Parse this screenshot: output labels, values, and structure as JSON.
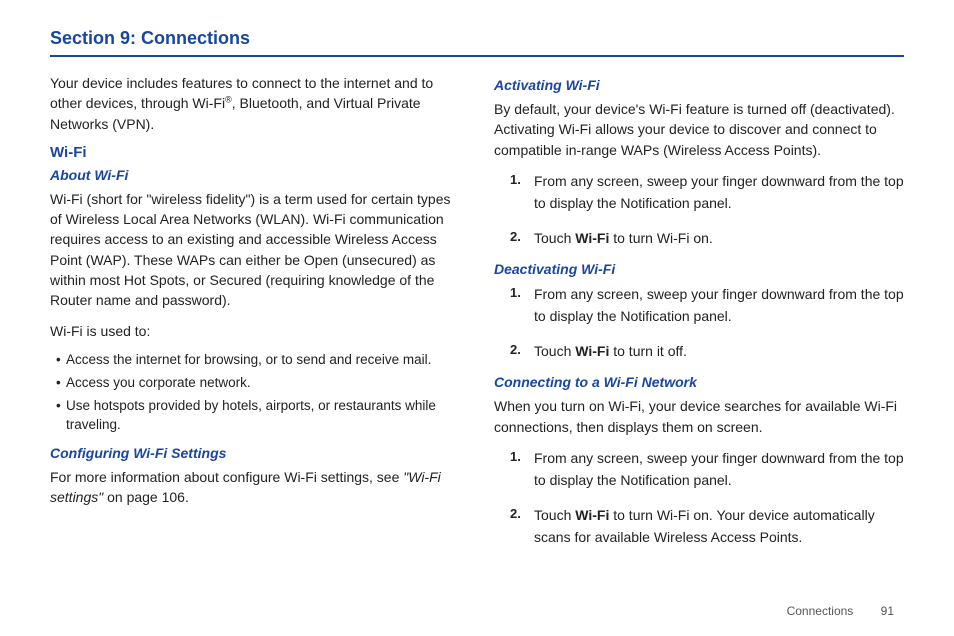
{
  "section_title": "Section 9: Connections",
  "left": {
    "intro_a": "Your device includes features to connect to the internet and to other devices, through Wi-Fi",
    "intro_reg": "®",
    "intro_b": ", Bluetooth, and Virtual Private Networks (VPN).",
    "h2_wifi": "Wi-Fi",
    "h3_about": "About Wi-Fi",
    "about_para": "Wi-Fi (short for \"wireless fidelity\") is a term used for certain types of Wireless Local Area Networks (WLAN). Wi-Fi communication requires access to an existing and accessible Wireless Access Point (WAP). These WAPs can either be Open (unsecured) as within most Hot Spots, or Secured (requiring knowledge of the Router name and password).",
    "usedto_label": "Wi-Fi is used to:",
    "bullets": [
      "Access the internet for browsing, or to send and receive mail.",
      "Access you corporate network.",
      "Use hotspots provided by hotels, airports, or restaurants while traveling."
    ],
    "h3_config": "Configuring Wi-Fi Settings",
    "config_a": "For more information about configure Wi-Fi settings, see ",
    "config_ref": "\"Wi-Fi settings\"",
    "config_b": " on page 106."
  },
  "right": {
    "h3_activate": "Activating Wi-Fi",
    "activate_para": "By default, your device's Wi-Fi feature is turned off (deactivated). Activating Wi-Fi allows your device to discover and connect to compatible in-range WAPs (Wireless Access Points).",
    "activate_steps": [
      {
        "a": "From any screen, sweep your finger downward from the top to display the Notification panel."
      },
      {
        "pre": "Touch ",
        "bold": "Wi-Fi",
        "post": " to turn Wi-Fi on."
      }
    ],
    "h3_deactivate": "Deactivating Wi-Fi",
    "deactivate_steps": [
      {
        "a": "From any screen, sweep your finger downward from the top to display the Notification panel."
      },
      {
        "pre": "Touch ",
        "bold": "Wi-Fi",
        "post": " to turn it off."
      }
    ],
    "h3_connecting": "Connecting to a Wi-Fi Network",
    "connecting_para": "When you turn on Wi-Fi, your device searches for available Wi-Fi connections, then displays them on screen.",
    "connecting_steps": [
      {
        "a": "From any screen, sweep your finger downward from the top to display the Notification panel."
      },
      {
        "pre": "Touch ",
        "bold": "Wi-Fi",
        "post": " to turn Wi-Fi on. Your device automatically scans for available Wireless Access Points."
      }
    ]
  },
  "footer": {
    "chapter": "Connections",
    "page": "91"
  }
}
